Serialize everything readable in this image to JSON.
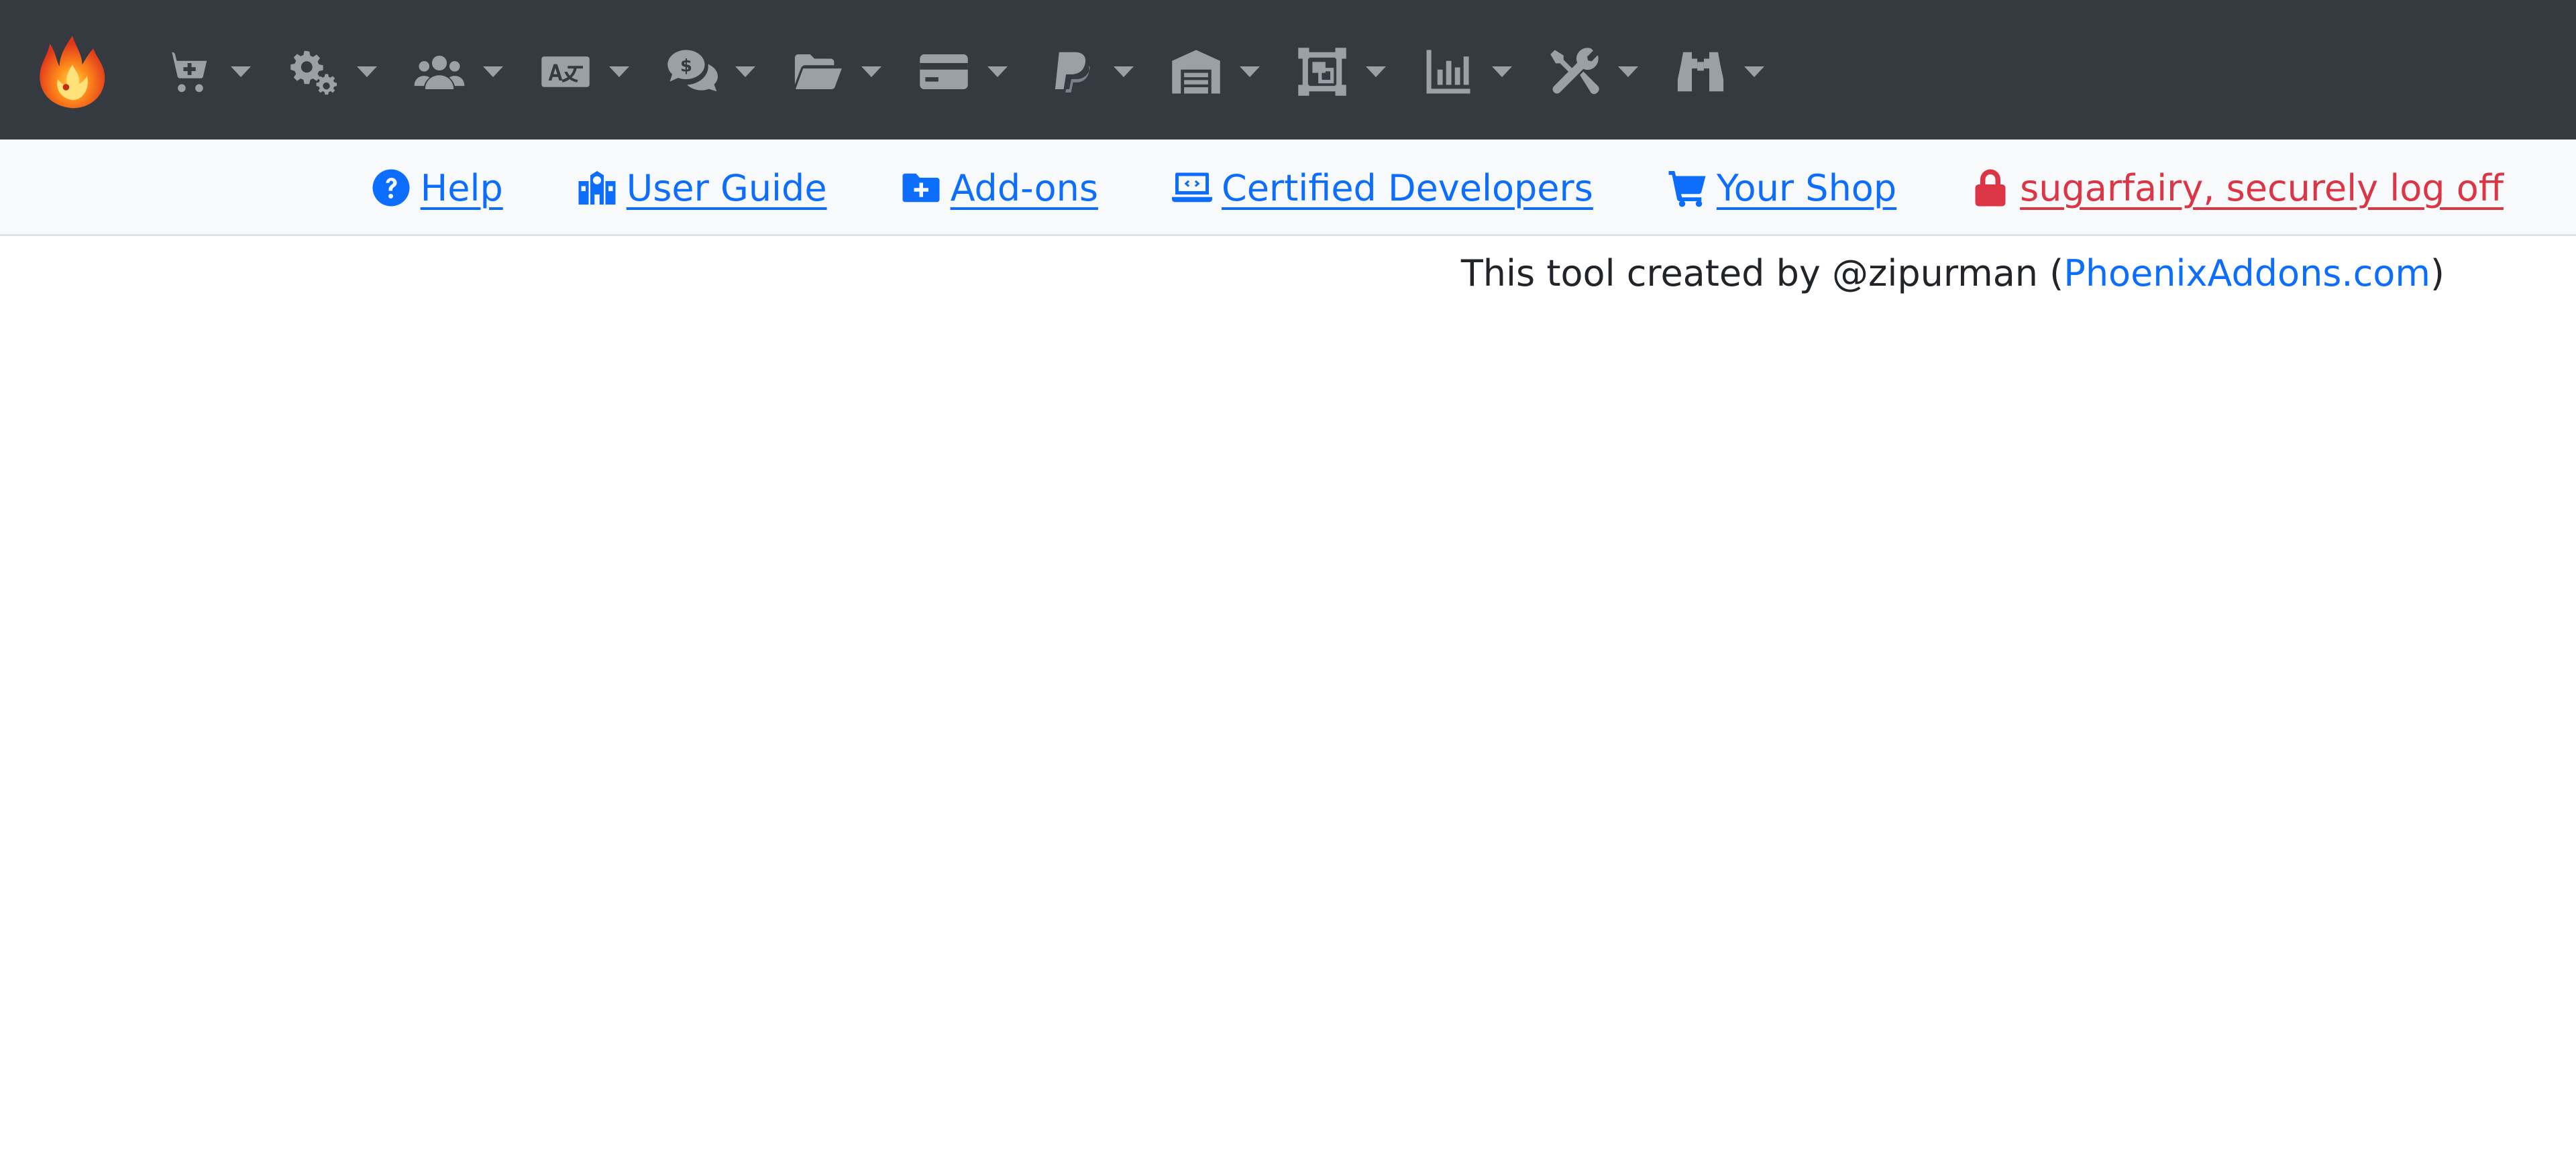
{
  "colors": {
    "navbar_bg": "#343a40",
    "navbar_icon": "#9aa0a6",
    "subnav_bg": "#f8f9fa",
    "link": "#0d6efd",
    "danger": "#dc3545"
  },
  "topnav": {
    "logo": "phoenix-logo",
    "menus": [
      {
        "icon": "cart-plus-icon"
      },
      {
        "icon": "gears-icon"
      },
      {
        "icon": "users-icon"
      },
      {
        "icon": "language-icon"
      },
      {
        "icon": "comments-dollar-icon"
      },
      {
        "icon": "folder-open-icon"
      },
      {
        "icon": "credit-card-icon"
      },
      {
        "icon": "paypal-icon"
      },
      {
        "icon": "warehouse-icon"
      },
      {
        "icon": "object-group-icon"
      },
      {
        "icon": "chart-bar-icon"
      },
      {
        "icon": "tools-icon"
      },
      {
        "icon": "binoculars-icon"
      }
    ]
  },
  "subnav": {
    "help": "Help",
    "user_guide": "User Guide",
    "addons": "Add-ons",
    "certified_developers": "Certified Developers",
    "your_shop": "Your Shop",
    "logoff": "sugarfairy, securely log off"
  },
  "credit": {
    "prefix": "This tool created by @zipurman (",
    "link_text": "PhoenixAddons.com",
    "suffix": ")"
  }
}
